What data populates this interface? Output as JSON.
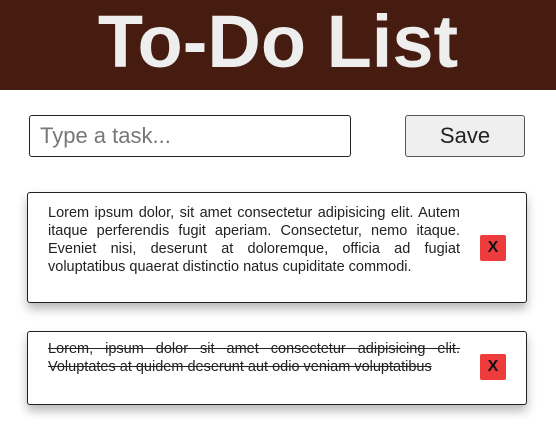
{
  "header": {
    "title": "To-Do List"
  },
  "form": {
    "input_placeholder": "Type a task...",
    "input_value": "",
    "save_label": "Save"
  },
  "tasks": [
    {
      "text": "Lorem ipsum dolor, sit amet consectetur adipisicing elit. Autem itaque perferendis fugit aperiam. Consectetur, nemo itaque. Eveniet nisi, deserunt at doloremque, officia ad fugiat voluptatibus quaerat distinctio natus cupiditate commodi.",
      "completed": false,
      "delete_label": "X"
    },
    {
      "text": "Lorem, ipsum dolor sit amet consectetur adipisicing elit. Voluptates at quidem deserunt aut odio veniam voluptatibus",
      "completed": true,
      "delete_label": "X"
    }
  ],
  "colors": {
    "header_bg": "#461b10",
    "header_text": "#eeeeee",
    "delete_button": "#ee3b3b"
  }
}
